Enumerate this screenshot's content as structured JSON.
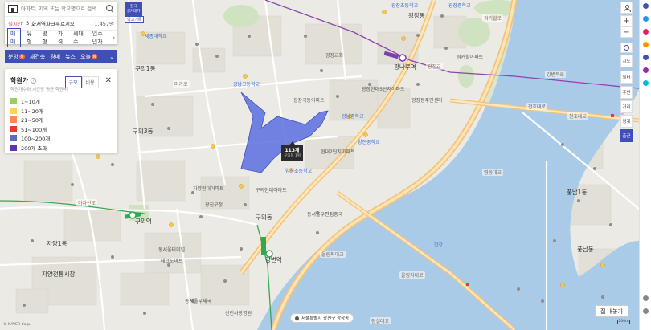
{
  "search": {
    "placeholder": "아파트, 지역 또는 학교명으로 검색"
  },
  "realtime": {
    "label": "실시간",
    "rank": "3",
    "name": "화서역파크푸르지오",
    "count": "1,457명"
  },
  "tabs": [
    "매매",
    "유형",
    "평형",
    "가격",
    "세대수",
    "입주년차"
  ],
  "categories": [
    {
      "label": "분양",
      "badge": "N"
    },
    {
      "label": "재건축"
    },
    {
      "label": "경매"
    },
    {
      "label": "뉴스"
    },
    {
      "label": "오늘",
      "badge": "N"
    }
  ],
  "legend": {
    "title": "학원가",
    "description": "학원개수와 시간당 평균 학원비",
    "toggle": [
      "규모",
      "비용"
    ],
    "items": [
      {
        "label": "1~10개",
        "color": "#9ccc65"
      },
      {
        "label": "11~20개",
        "color": "#ffd54f"
      },
      {
        "label": "21~50개",
        "color": "#ff8a50"
      },
      {
        "label": "51~100개",
        "color": "#e53935"
      },
      {
        "label": "100~200개",
        "color": "#5c6bc0"
      },
      {
        "label": "200개 초과",
        "color": "#5e35b1"
      }
    ]
  },
  "tooltip": {
    "count": "113개",
    "area": "구의동 1위"
  },
  "realtrade": {
    "line1": "전국",
    "line2": "실거래가",
    "tag": "학교기록"
  },
  "controls": {
    "zoom_in": "+",
    "zoom_out": "−",
    "items": [
      "지도",
      "필터",
      "주변",
      "거리",
      "경계",
      "출근"
    ]
  },
  "map_labels": [
    "광장동",
    "광장초등학교",
    "광장중학교",
    "워커힐로",
    "구의역",
    "자양1동",
    "자양전통시장",
    "동서울터미널",
    "테크노마트",
    "강변역",
    "광남고등학교",
    "광남중학교",
    "양진중학교",
    "양진초등학교",
    "구의동",
    "아차산로",
    "천호대로",
    "올림픽대로",
    "강변북로",
    "광진교",
    "천호대교",
    "풍납동",
    "풍납1동",
    "구의3동",
    "현대2단지아파트",
    "동서울우편집중국",
    "광장현대5단지아파트",
    "광장극동아파트",
    "구의현대아파트",
    "자양현대아파트",
    "광진구청",
    "미가로",
    "광나루역",
    "한강",
    "올림픽대교",
    "워커힐아파트",
    "구의1동",
    "광장동주민센터",
    "세종대학교",
    "동서울우체국",
    "선린사랑병원",
    "광장교회",
    "영동대교",
    "잠실대교"
  ],
  "address": "서울특별시 광진구 광장동",
  "sell_button": "집 내놓기",
  "credit": "© NAVER Corp.",
  "scale": "200m"
}
